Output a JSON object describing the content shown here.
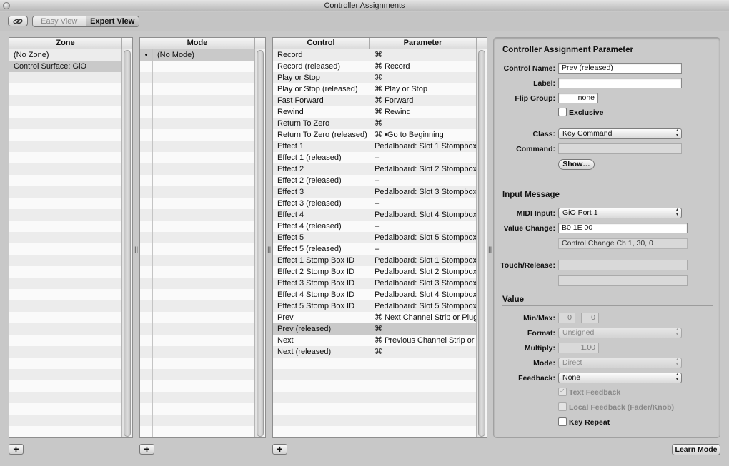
{
  "window": {
    "title": "Controller Assignments"
  },
  "toolbar": {
    "link_icon": "link-icon",
    "easy_view": "Easy View",
    "expert_view": "Expert View"
  },
  "zone": {
    "header": "Zone",
    "items": [
      "(No Zone)",
      "Control Surface: GiO"
    ],
    "selected_index": 1
  },
  "mode": {
    "header": "Mode",
    "items": [
      {
        "bullet": "•",
        "label": "(No Mode)"
      }
    ],
    "selected_index": 0
  },
  "control": {
    "header_control": "Control",
    "header_parameter": "Parameter",
    "selected_index": 24,
    "rows": [
      {
        "control": "Record",
        "parameter": "⌘"
      },
      {
        "control": "Record (released)",
        "parameter": "⌘ Record"
      },
      {
        "control": "Play or Stop",
        "parameter": "⌘"
      },
      {
        "control": "Play or Stop (released)",
        "parameter": "⌘ Play or Stop"
      },
      {
        "control": "Fast Forward",
        "parameter": "⌘ Forward"
      },
      {
        "control": "Rewind",
        "parameter": "⌘ Rewind"
      },
      {
        "control": "Return To Zero",
        "parameter": "⌘"
      },
      {
        "control": "Return To Zero (released)",
        "parameter": "⌘ •Go to Beginning"
      },
      {
        "control": "Effect 1",
        "parameter": "Pedalboard: Slot 1 Stompbox"
      },
      {
        "control": "Effect 1 (released)",
        "parameter": "–"
      },
      {
        "control": "Effect 2",
        "parameter": "Pedalboard: Slot 2 Stompbox"
      },
      {
        "control": "Effect 2 (released)",
        "parameter": "–"
      },
      {
        "control": "Effect 3",
        "parameter": "Pedalboard: Slot 3 Stompbox"
      },
      {
        "control": "Effect 3 (released)",
        "parameter": "–"
      },
      {
        "control": "Effect 4",
        "parameter": "Pedalboard: Slot 4 Stompbox"
      },
      {
        "control": "Effect 4 (released)",
        "parameter": "–"
      },
      {
        "control": "Effect 5",
        "parameter": "Pedalboard: Slot 5 Stompbox"
      },
      {
        "control": "Effect 5 (released)",
        "parameter": "–"
      },
      {
        "control": "Effect 1 Stomp Box ID",
        "parameter": "Pedalboard: Slot 1 Stompbox"
      },
      {
        "control": "Effect 2 Stomp Box ID",
        "parameter": "Pedalboard: Slot 2 Stompbox"
      },
      {
        "control": "Effect 3 Stomp Box ID",
        "parameter": "Pedalboard: Slot 3 Stompbox"
      },
      {
        "control": "Effect 4 Stomp Box ID",
        "parameter": "Pedalboard: Slot 4 Stompbox"
      },
      {
        "control": "Effect 5 Stomp Box ID",
        "parameter": "Pedalboard: Slot 5 Stompbox"
      },
      {
        "control": "Prev",
        "parameter": "⌘ Next Channel Strip or Plug"
      },
      {
        "control": "Prev (released)",
        "parameter": "⌘"
      },
      {
        "control": "Next",
        "parameter": "⌘ Previous Channel Strip or"
      },
      {
        "control": "Next (released)",
        "parameter": "⌘"
      }
    ]
  },
  "splitter_glyph": "||",
  "add_label": "+",
  "inspector": {
    "section_title": "Controller Assignment Parameter",
    "control_name_label": "Control Name:",
    "control_name_value": "Prev (released)",
    "label_label": "Label:",
    "label_value": "",
    "flip_group_label": "Flip Group:",
    "flip_group_value": "none",
    "exclusive_label": "Exclusive",
    "exclusive_checked": false,
    "class_label": "Class:",
    "class_value": "Key Command",
    "command_label": "Command:",
    "command_value": "",
    "show_button": "Show…",
    "input_section": "Input Message",
    "midi_input_label": "MIDI Input:",
    "midi_input_value": "GiO Port 1",
    "value_change_label": "Value Change:",
    "value_change_value": "B0 1E 00",
    "value_change_info": "Control Change Ch 1, 30, 0",
    "touch_release_label": "Touch/Release:",
    "value_section": "Value",
    "minmax_label": "Min/Max:",
    "min_value": "0",
    "max_value": "0",
    "format_label": "Format:",
    "format_value": "Unsigned",
    "multiply_label": "Multiply:",
    "multiply_value": "1.00",
    "mode_label": "Mode:",
    "mode_value": "Direct",
    "feedback_label": "Feedback:",
    "feedback_value": "None",
    "text_feedback_label": "Text Feedback",
    "text_feedback_checked": true,
    "local_feedback_label": "Local Feedback (Fader/Knob)",
    "local_feedback_checked": false,
    "key_repeat_label": "Key Repeat",
    "key_repeat_checked": false,
    "check_glyph": "✓"
  },
  "learn_mode_button": "Learn Mode"
}
